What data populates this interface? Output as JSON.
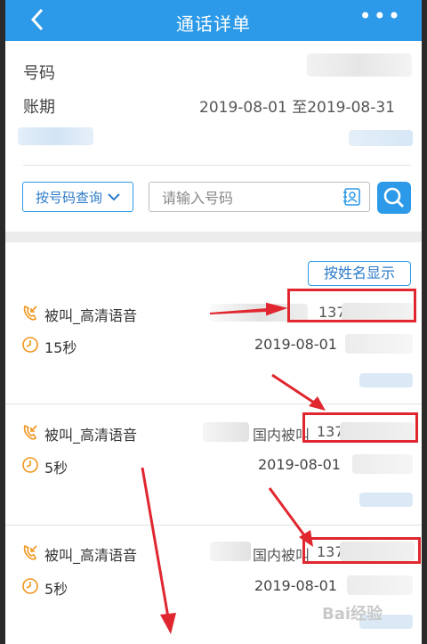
{
  "header": {
    "title": "通话详单",
    "back_icon": "chevron-left-icon",
    "more_label": "•••"
  },
  "info": {
    "number_label": "号码",
    "period_label": "账期",
    "period_value": "2019-08-01 至2019-08-31"
  },
  "query": {
    "mode_label": "按号码查询",
    "search_placeholder": "请输入号码"
  },
  "list": {
    "toggle_label": "按姓名显示",
    "records": [
      {
        "type": "被叫_高清语音",
        "duration": "15秒",
        "date": "2019-08-01",
        "number": "137"
      },
      {
        "type": "被叫_高清语音",
        "duration": "5秒",
        "date": "2019-08-01",
        "place": "国内被叫",
        "number": "137"
      },
      {
        "type": "被叫_高清语音",
        "duration": "5秒",
        "date": "2019-08-01",
        "place": "国内被叫",
        "number": "137"
      }
    ]
  },
  "watermark": "Bai经验",
  "colors": {
    "accent": "#2c9ae8",
    "highlight": "#e0262e",
    "icon_orange": "#f0961e"
  }
}
